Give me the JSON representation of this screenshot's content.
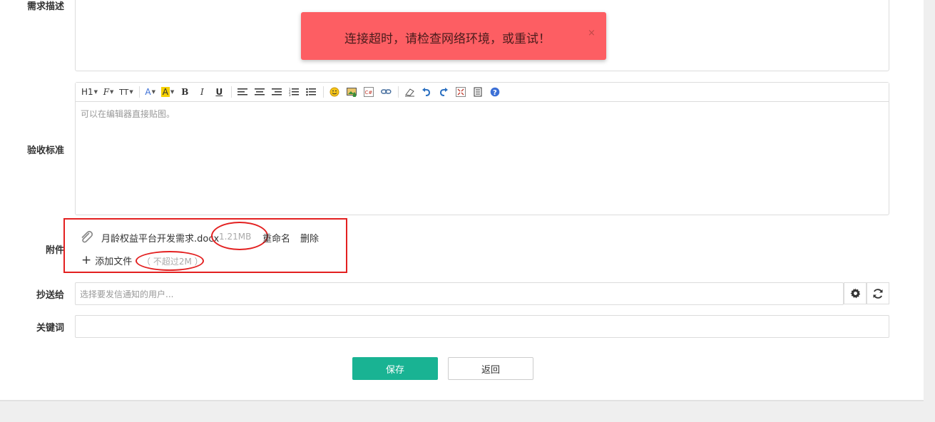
{
  "labels": {
    "description": "需求描述",
    "acceptance": "验收标准",
    "attachment": "附件",
    "cc": "抄送给",
    "keywords": "关键词"
  },
  "editor": {
    "toolbar": {
      "heading": "H1",
      "font_family": "F",
      "font_size": "TT",
      "font_color": "A",
      "highlight": "A",
      "bold": "B",
      "italic": "I",
      "underline": "U",
      "code": "C#"
    },
    "placeholder": "可以在编辑器直接贴图。"
  },
  "attachment": {
    "file_name": "月龄权益平台开发需求.docx",
    "file_size": "1.21MB",
    "rename": "重命名",
    "delete": "删除",
    "add_file": "添加文件",
    "limit": "（ 不超过2M ）"
  },
  "cc": {
    "placeholder": "选择要发信通知的用户..."
  },
  "keywords": {
    "value": ""
  },
  "buttons": {
    "save": "保存",
    "back": "返回"
  },
  "toast": {
    "message": "连接超时，请检查网络环境，或重试！",
    "close": "×"
  },
  "colors": {
    "primary": "#19b393",
    "toast_bg": "#fd5e63",
    "annotation_red": "#e32020"
  }
}
